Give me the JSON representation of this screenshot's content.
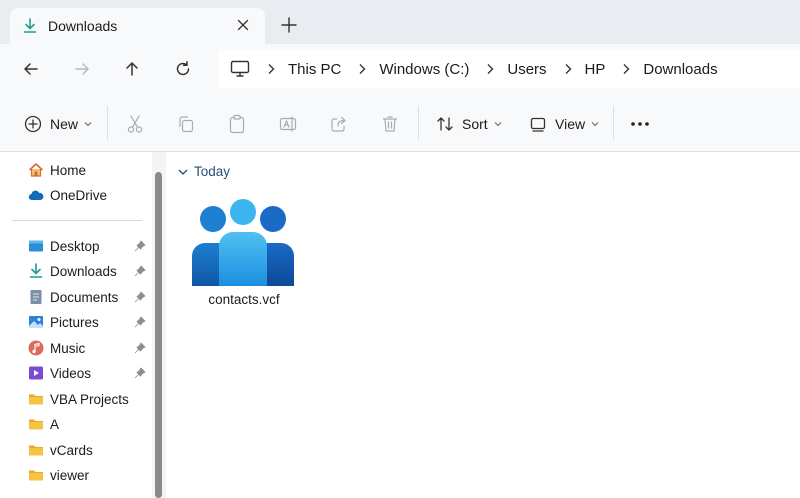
{
  "tab": {
    "title": "Downloads",
    "icon": "download-icon"
  },
  "breadcrumb": [
    "This PC",
    "Windows (C:)",
    "Users",
    "HP",
    "Downloads"
  ],
  "toolbar": {
    "new_label": "New",
    "sort_label": "Sort",
    "view_label": "View"
  },
  "sidebar": {
    "top": [
      {
        "label": "Home",
        "icon": "home-icon"
      },
      {
        "label": "OneDrive",
        "icon": "cloud-icon"
      }
    ],
    "pinned": [
      {
        "label": "Desktop",
        "icon": "desktop-icon"
      },
      {
        "label": "Downloads",
        "icon": "download-icon"
      },
      {
        "label": "Documents",
        "icon": "document-icon"
      },
      {
        "label": "Pictures",
        "icon": "picture-icon"
      },
      {
        "label": "Music",
        "icon": "music-icon"
      },
      {
        "label": "Videos",
        "icon": "video-icon"
      }
    ],
    "folders": [
      {
        "label": "VBA Projects",
        "icon": "folder-icon"
      },
      {
        "label": "A",
        "icon": "folder-icon"
      },
      {
        "label": "vCards",
        "icon": "folder-icon"
      },
      {
        "label": "viewer",
        "icon": "folder-icon"
      }
    ]
  },
  "content": {
    "group_label": "Today",
    "files": [
      {
        "name": "contacts.vcf",
        "icon": "contacts-icon"
      }
    ]
  },
  "colors": {
    "accent": "#1f9e8f",
    "group_header": "#2a4d7a",
    "folder": "#f5c542"
  }
}
